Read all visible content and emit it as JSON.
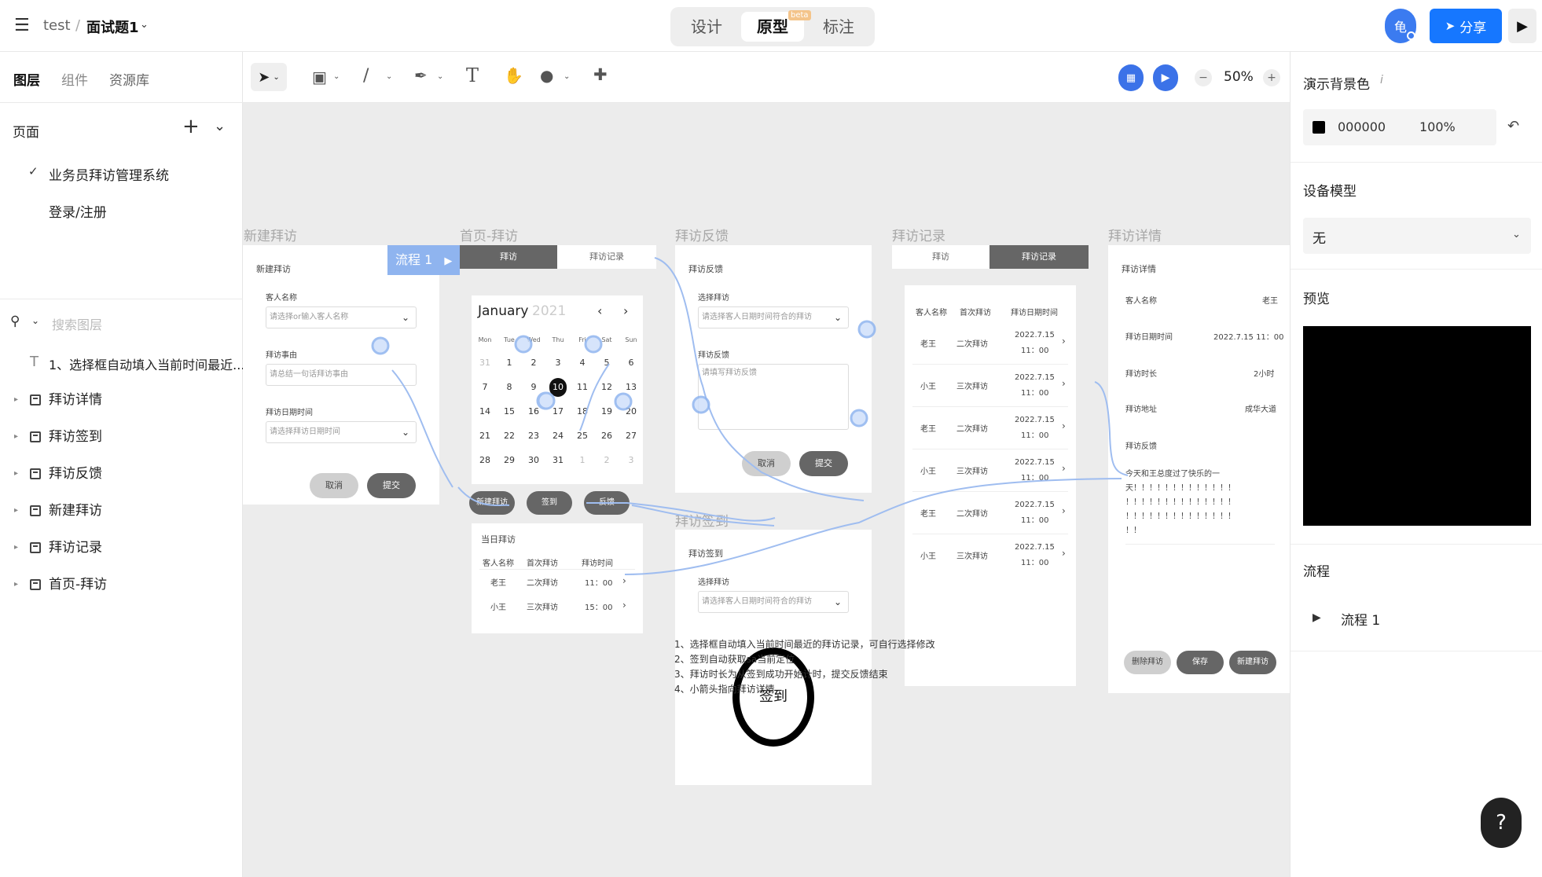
{
  "header": {
    "project": "test",
    "separator": "/",
    "file": "面试题1",
    "tabs": [
      {
        "label": "设计"
      },
      {
        "label": "原型",
        "badge": "beta"
      },
      {
        "label": "标注"
      }
    ],
    "avatar": "龟",
    "share_label": "分享"
  },
  "left": {
    "tabs": [
      "图层",
      "组件",
      "资源库"
    ],
    "pages_title": "页面",
    "pages": [
      "业务员拜访管理系统",
      "登录/注册"
    ],
    "search_placeholder": "搜索图层",
    "layers": [
      "1、选择框自动填入当前时间最近...",
      "拜访详情",
      "拜访签到",
      "拜访反馈",
      "新建拜访",
      "拜访记录",
      "首页-拜访"
    ]
  },
  "toolbar": {
    "zoom": "50%"
  },
  "right": {
    "bg_title": "演示背景色",
    "bg_hex": "000000",
    "bg_opacity": "100%",
    "device_title": "设备模型",
    "device_value": "无",
    "preview_title": "预览",
    "flow_title": "流程",
    "flow_item": "流程 1"
  },
  "canvas": {
    "frame_titles": [
      "新建拜访",
      "首页-拜访",
      "拜访反馈",
      "拜访记录",
      "拜访详情",
      "拜访签到"
    ],
    "flow_badge": "流程 1",
    "new_visit": {
      "title": "新建拜访",
      "customer_label": "客人名称",
      "customer_ph": "请选择or输入客人名称",
      "reason_label": "拜访事由",
      "reason_ph": "请总结一句话拜访事由",
      "date_label": "拜访日期时间",
      "date_ph": "请选择拜访日期时间",
      "cancel": "取消",
      "submit": "提交"
    },
    "home": {
      "tab_visit": "拜访",
      "tab_records": "拜访记录",
      "month": "January",
      "year": "2021",
      "weekdays": [
        "Mon",
        "Tue",
        "Wed",
        "Thu",
        "Fri",
        "Sat",
        "Sun"
      ],
      "days": [
        [
          "31",
          "1",
          "2",
          "3",
          "4",
          "5",
          "6"
        ],
        [
          "7",
          "8",
          "9",
          "10",
          "11",
          "12",
          "13"
        ],
        [
          "14",
          "15",
          "16",
          "17",
          "18",
          "19",
          "20"
        ],
        [
          "21",
          "22",
          "23",
          "24",
          "25",
          "26",
          "27"
        ],
        [
          "28",
          "29",
          "30",
          "31",
          "1",
          "2",
          "3"
        ]
      ],
      "btn_new": "新建拜访",
      "btn_checkin": "签到",
      "btn_feedback": "反馈",
      "today_title": "当日拜访",
      "cols": [
        "客人名称",
        "首次拜访",
        "拜访时间"
      ],
      "rows": [
        [
          "老王",
          "二次拜访",
          "11：00"
        ],
        [
          "小王",
          "三次拜访",
          "15：00"
        ]
      ]
    },
    "feedback": {
      "title": "拜访反馈",
      "select_label": "选择拜访",
      "select_ph": "请选择客人日期时间符合的拜访",
      "fb_label": "拜访反馈",
      "fb_ph": "请填写拜访反馈",
      "cancel": "取消",
      "submit": "提交"
    },
    "checkin": {
      "title": "拜访签到",
      "select_label": "选择拜访",
      "select_ph": "请选择客人日期时间符合的拜访",
      "button": "签到"
    },
    "records": {
      "tab_visit": "拜访",
      "tab_records": "拜访记录",
      "cols": [
        "客人名称",
        "首次拜访",
        "拜访日期时间"
      ],
      "rows": [
        [
          "老王",
          "二次拜访",
          "2022.7.15",
          "11：00"
        ],
        [
          "小王",
          "三次拜访",
          "2022.7.15",
          "11：00"
        ],
        [
          "老王",
          "二次拜访",
          "2022.7.15",
          "11：00"
        ],
        [
          "小王",
          "三次拜访",
          "2022.7.15",
          "11：00"
        ],
        [
          "老王",
          "二次拜访",
          "2022.7.15",
          "11：00"
        ],
        [
          "小王",
          "三次拜访",
          "2022.7.15",
          "11：00"
        ]
      ]
    },
    "detail": {
      "title": "拜访详情",
      "fields": [
        [
          "客人名称",
          "老王"
        ],
        [
          "拜访日期时间",
          "2022.7.15  11：00"
        ],
        [
          "拜访时长",
          "2小时"
        ],
        [
          "拜访地址",
          "成华大道"
        ]
      ],
      "fb_label": "拜访反馈",
      "fb_text": [
        "今天和王总度过了快乐的一",
        "天！！！！！！！！！！！！！",
        "！！！！！！！！！！！！！！",
        "！！！！！！！！！！！！！！",
        "！！"
      ],
      "btn_delete": "删除拜访",
      "btn_save": "保存",
      "btn_new": "新建拜访"
    },
    "notes": [
      "1、选择框自动填入当前时间最近的拜访记录，可自行选择修改",
      "2、签到自动获取sa当前定位",
      "3、拜访时长为从签到成功开始计时，提交反馈结束",
      "4、小箭头指向拜访详情"
    ]
  },
  "colors": {
    "accent": "#1677ff",
    "flow": "#8fb4ef",
    "canvas_bg": "#ececec"
  }
}
